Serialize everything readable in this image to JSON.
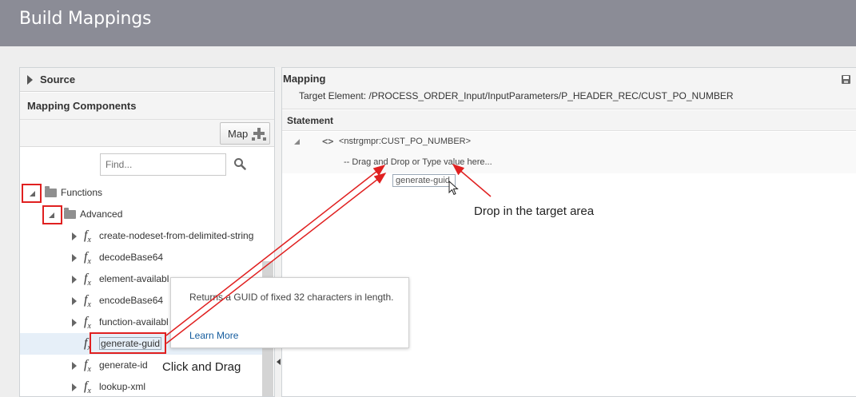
{
  "app": {
    "title": "Build Mappings"
  },
  "left": {
    "source_label": "Source",
    "components_label": "Mapping Components",
    "map_button_label": "Map",
    "find_placeholder": "Find...",
    "tree": {
      "functions_label": "Functions",
      "advanced_label": "Advanced",
      "functions": [
        "create-nodeset-from-delimited-string",
        "decodeBase64",
        "element-availabl",
        "encodeBase64",
        "function-availabl",
        "generate-guid",
        "generate-id",
        "lookup-xml"
      ]
    }
  },
  "right": {
    "mapping_label": "Mapping",
    "target_element": "Target Element:   /PROCESS_ORDER_Input/InputParameters/P_HEADER_REC/CUST_PO_NUMBER",
    "statement_label": "Statement",
    "node_name": "<nstrgmpr:CUST_PO_NUMBER>",
    "drag_placeholder": "-- Drag and Drop or Type value here...",
    "dragged_chip": "generate-guid"
  },
  "tooltip": {
    "description": "Returns a GUID of fixed 32 characters in length.",
    "link": "Learn More"
  },
  "annotations": {
    "drop_note": "Drop in the target area",
    "drag_note": "Click and Drag",
    "color": "#e02020"
  },
  "icons": {
    "search": "search-icon",
    "save": "save-icon",
    "function": "function-icon",
    "folder": "folder-icon"
  }
}
